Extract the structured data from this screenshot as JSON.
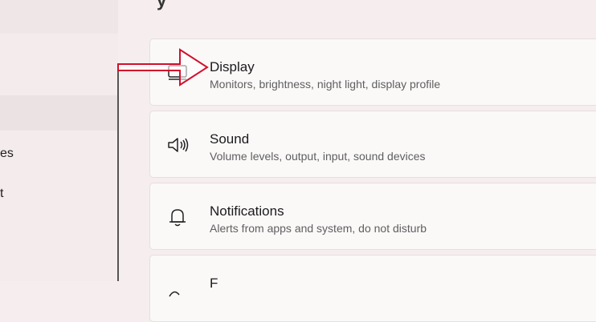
{
  "page": {
    "title_fragment": "y"
  },
  "sidebar": {
    "items": [
      {
        "label": "es"
      },
      {
        "label": "t"
      }
    ]
  },
  "settings": [
    {
      "title": "Display",
      "subtitle": "Monitors, brightness, night light, display profile",
      "icon": "monitor-icon"
    },
    {
      "title": "Sound",
      "subtitle": "Volume levels, output, input, sound devices",
      "icon": "speaker-icon"
    },
    {
      "title": "Notifications",
      "subtitle": "Alerts from apps and system, do not disturb",
      "icon": "bell-icon"
    },
    {
      "title": "F",
      "subtitle": "",
      "icon": "focus-icon"
    }
  ],
  "annotation": {
    "color": "#d2102c"
  }
}
